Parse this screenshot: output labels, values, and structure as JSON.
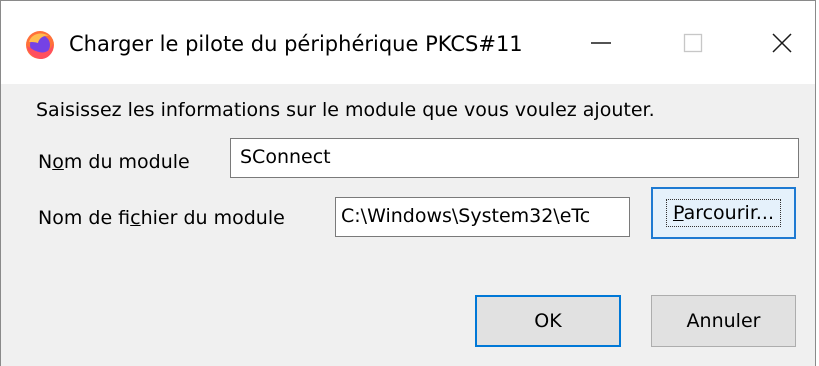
{
  "window": {
    "title": "Charger le pilote du périphérique PKCS#11",
    "app_icon": "firefox-icon",
    "controls": {
      "minimize_icon": "minimize-icon",
      "maximize_icon": "maximize-icon",
      "close_icon": "close-icon"
    }
  },
  "form": {
    "instructions": "Saisissez les informations sur le module que vous voulez ajouter.",
    "module_name_label_pre": "N",
    "module_name_label_accel": "o",
    "module_name_label_post": "m du module",
    "module_name_value": "SConnect",
    "module_file_label_pre": "Nom de fi",
    "module_file_label_accel": "c",
    "module_file_label_post": "hier du module",
    "module_file_value": "C:\\Windows\\System32\\eTc"
  },
  "buttons": {
    "browse_accel": "P",
    "browse_rest": "arcourir...",
    "ok": "OK",
    "cancel": "Annuler"
  },
  "colors": {
    "focus_blue": "#0078d7",
    "dialog_bg": "#f0f0f0",
    "titlebar_bg": "#ffffff"
  }
}
